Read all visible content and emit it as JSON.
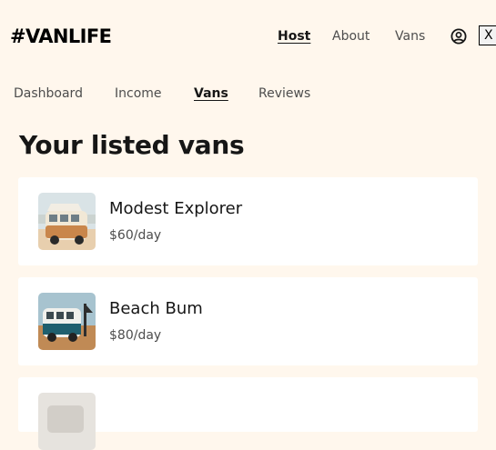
{
  "header": {
    "logo": "#VANLIFE",
    "nav": {
      "host": "Host",
      "about": "About",
      "vans": "Vans"
    },
    "close_label": "X",
    "user_icon": "user-circle-icon"
  },
  "subnav": {
    "dashboard": "Dashboard",
    "income": "Income",
    "vans": "Vans",
    "reviews": "Reviews"
  },
  "page": {
    "title": "Your listed vans"
  },
  "vans": [
    {
      "name": "Modest Explorer",
      "price": "$60/day",
      "thumb": "van-photo-beige"
    },
    {
      "name": "Beach Bum",
      "price": "$80/day",
      "thumb": "van-photo-teal"
    },
    {
      "name": "",
      "price": "",
      "thumb": "van-photo-partial"
    }
  ],
  "colors": {
    "background": "#FFF7ED",
    "card": "#FFFFFF",
    "text": "#161616",
    "muted": "#4D4D4D"
  }
}
